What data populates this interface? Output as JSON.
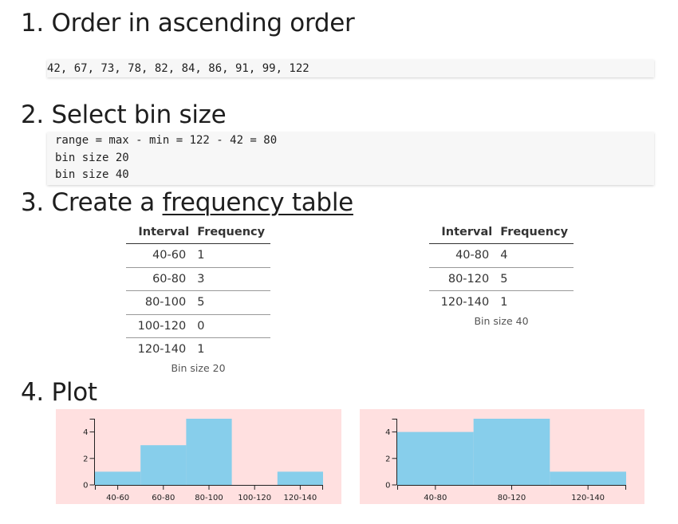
{
  "sections": {
    "order_title": "1. Order in ascending order",
    "bin_title": "2. Select bin size",
    "table_title_prefix": "3. Create a ",
    "table_title_link": "frequency table",
    "plot_title": "4. Plot"
  },
  "sorted_values": "42, 67, 73, 78, 82, 84, 86, 91, 99, 122",
  "bin_code": [
    "range = max - min = 122 - 42 = 80",
    "bin size 20",
    "bin size 40"
  ],
  "tables": {
    "headers": {
      "interval": "Interval",
      "frequency": "Frequency"
    },
    "bin20": {
      "caption": "Bin size 20",
      "rows": [
        {
          "interval": "40-60",
          "frequency": "1"
        },
        {
          "interval": "60-80",
          "frequency": "3"
        },
        {
          "interval": "80-100",
          "frequency": "5"
        },
        {
          "interval": "100-120",
          "frequency": "0"
        },
        {
          "interval": "120-140",
          "frequency": "1"
        }
      ]
    },
    "bin40": {
      "caption": "Bin size 40",
      "rows": [
        {
          "interval": "40-80",
          "frequency": "4"
        },
        {
          "interval": "80-120",
          "frequency": "5"
        },
        {
          "interval": "120-140",
          "frequency": "1"
        }
      ]
    }
  },
  "colors": {
    "plot_background": "#ffe0e0",
    "bar": "#87ceeb",
    "axis": "#222222"
  },
  "chart_data": [
    {
      "type": "bar",
      "categories": [
        "40-60",
        "60-80",
        "80-100",
        "100-120",
        "120-140"
      ],
      "values": [
        1,
        3,
        5,
        0,
        1
      ],
      "y_ticks": [
        0,
        2,
        4
      ],
      "ylim": [
        0,
        5
      ],
      "grid": false
    },
    {
      "type": "bar",
      "categories": [
        "40-80",
        "80-120",
        "120-140"
      ],
      "values": [
        4,
        5,
        1
      ],
      "y_ticks": [
        0,
        2,
        4
      ],
      "ylim": [
        0,
        5
      ],
      "grid": false
    }
  ]
}
